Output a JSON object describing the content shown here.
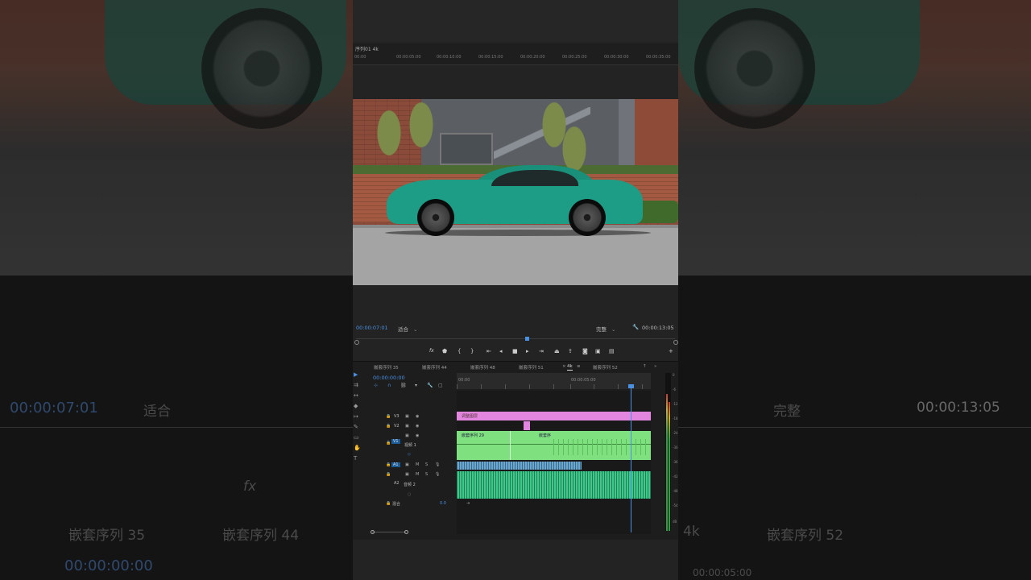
{
  "background_overlay": {
    "left_timecode": "00:00:07:01",
    "left_fit": "适合",
    "right_quality": "完整",
    "right_timecode": "00:00:13:05",
    "left_tab_a": "嵌套序列 35",
    "left_tab_b": "嵌套序列 44",
    "right_tab_4k": "4k",
    "right_tab_52": "嵌套序列 52",
    "left_tl_timecode": "00:00:00:00",
    "right_ruler": "00:00:05:00",
    "fx": "fx"
  },
  "source_ruler": {
    "label": "序列01 4k",
    "ticks": [
      "00:00",
      "00:00:05:00",
      "00:00:10:00",
      "00:00:15:00",
      "00:00:20:00",
      "00:00:25:00",
      "00:00:30:00",
      "00:00:35:00"
    ]
  },
  "program_monitor": {
    "current_timecode": "00:00:07:01",
    "fit": "适合",
    "quality": "完整",
    "duration": "00:00:13:05",
    "wrench_icon": "wrench-icon"
  },
  "timeline": {
    "tabs": [
      "嵌套序列 35",
      "嵌套序列 44",
      "嵌套序列 48",
      "嵌套序列 51",
      "4k",
      "嵌套序列 52"
    ],
    "active_tab": "4k",
    "timecode": "00:00:00:00",
    "ruler": [
      "00:00",
      "00:00:05:00"
    ],
    "tracks": {
      "v3": "V3",
      "v2": "V2",
      "v1": "V1",
      "video1_name": "视频 1",
      "a1": "A1",
      "a2": "A2",
      "audio2_name": "音频 2",
      "master": "混合",
      "master_value": "0.0"
    },
    "clips": {
      "adjustment": "调整图层",
      "nested": "嵌套序列 29",
      "nested2": "嵌套序"
    },
    "vu_labels": [
      "0",
      "-6",
      "-12",
      "-18",
      "-24",
      "-30",
      "-36",
      "-42",
      "-48",
      "-54",
      "dB"
    ]
  }
}
